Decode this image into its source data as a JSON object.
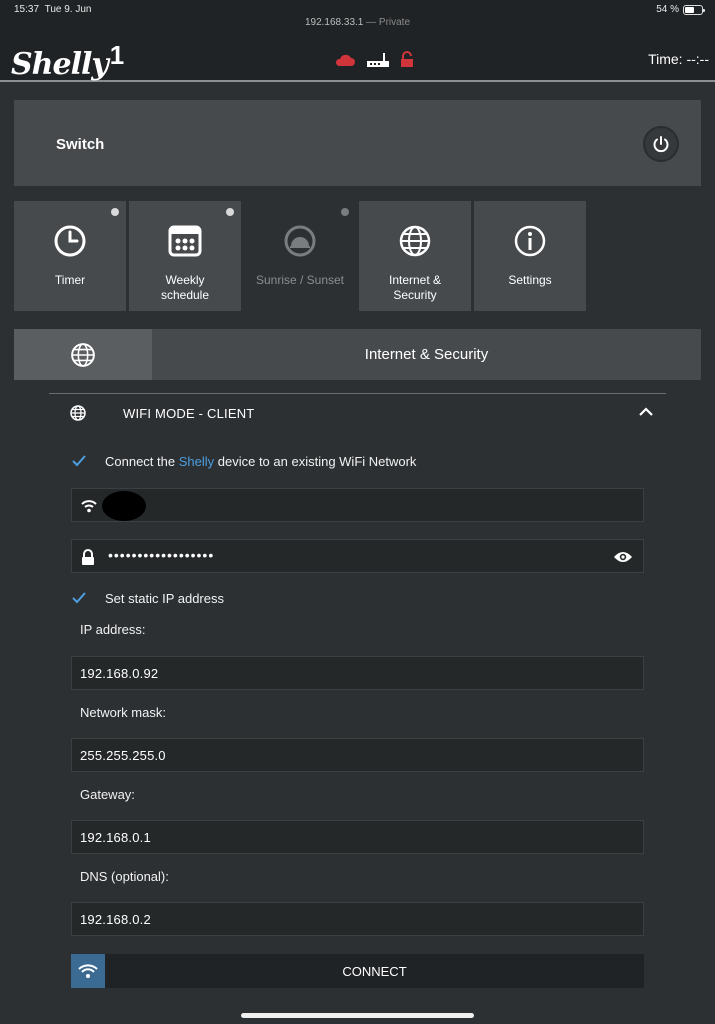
{
  "status_bar": {
    "time": "15:37",
    "date": "Tue 9. Jun",
    "url": "192.168.33.1",
    "private": "— Private",
    "battery_text": "54 %",
    "battery_level": 0.54
  },
  "header": {
    "logo_text": "Shelly",
    "logo_model": "1",
    "time_text": "Time: --:--",
    "icons": [
      "cloud-icon",
      "router-icon",
      "lock-open-icon"
    ],
    "colors": {
      "alert": "#d0353b"
    }
  },
  "switch": {
    "label": "Switch",
    "icon": "power-icon"
  },
  "tiles": [
    {
      "label_line1": "Timer",
      "label_line2": "",
      "icon": "clock-icon"
    },
    {
      "label_line1": "Weekly",
      "label_line2": "schedule",
      "icon": "calendar-icon"
    },
    {
      "label_line1": "Sunrise / Sunset",
      "label_line2": "",
      "icon": "sunset-icon"
    },
    {
      "label_line1": "Internet &",
      "label_line2": "Security",
      "icon": "globe-icon"
    },
    {
      "label_line1": "Settings",
      "label_line2": "",
      "icon": "info-icon"
    }
  ],
  "section": {
    "title": "Internet & Security",
    "icon": "globe-icon"
  },
  "wifi": {
    "title": "WIFI MODE - CLIENT",
    "connect_prefix": "Connect the ",
    "connect_highlight": "Shelly",
    "connect_suffix": " device to an existing WiFi Network",
    "ssid_value": "",
    "password_dots": "••••••••••••••••••",
    "static_ip_label": "Set static IP address",
    "ip_label": "IP address:",
    "ip_value": "192.168.0.92",
    "mask_label": "Network mask:",
    "mask_value": "255.255.255.0",
    "gateway_label": "Gateway:",
    "gateway_value": "192.168.0.1",
    "dns_label": "DNS (optional):",
    "dns_value": "192.168.0.2",
    "connect_button": "CONNECT",
    "colors": {
      "accent": "#4d9de0",
      "button_icon_bg": "#3b6a93"
    }
  }
}
